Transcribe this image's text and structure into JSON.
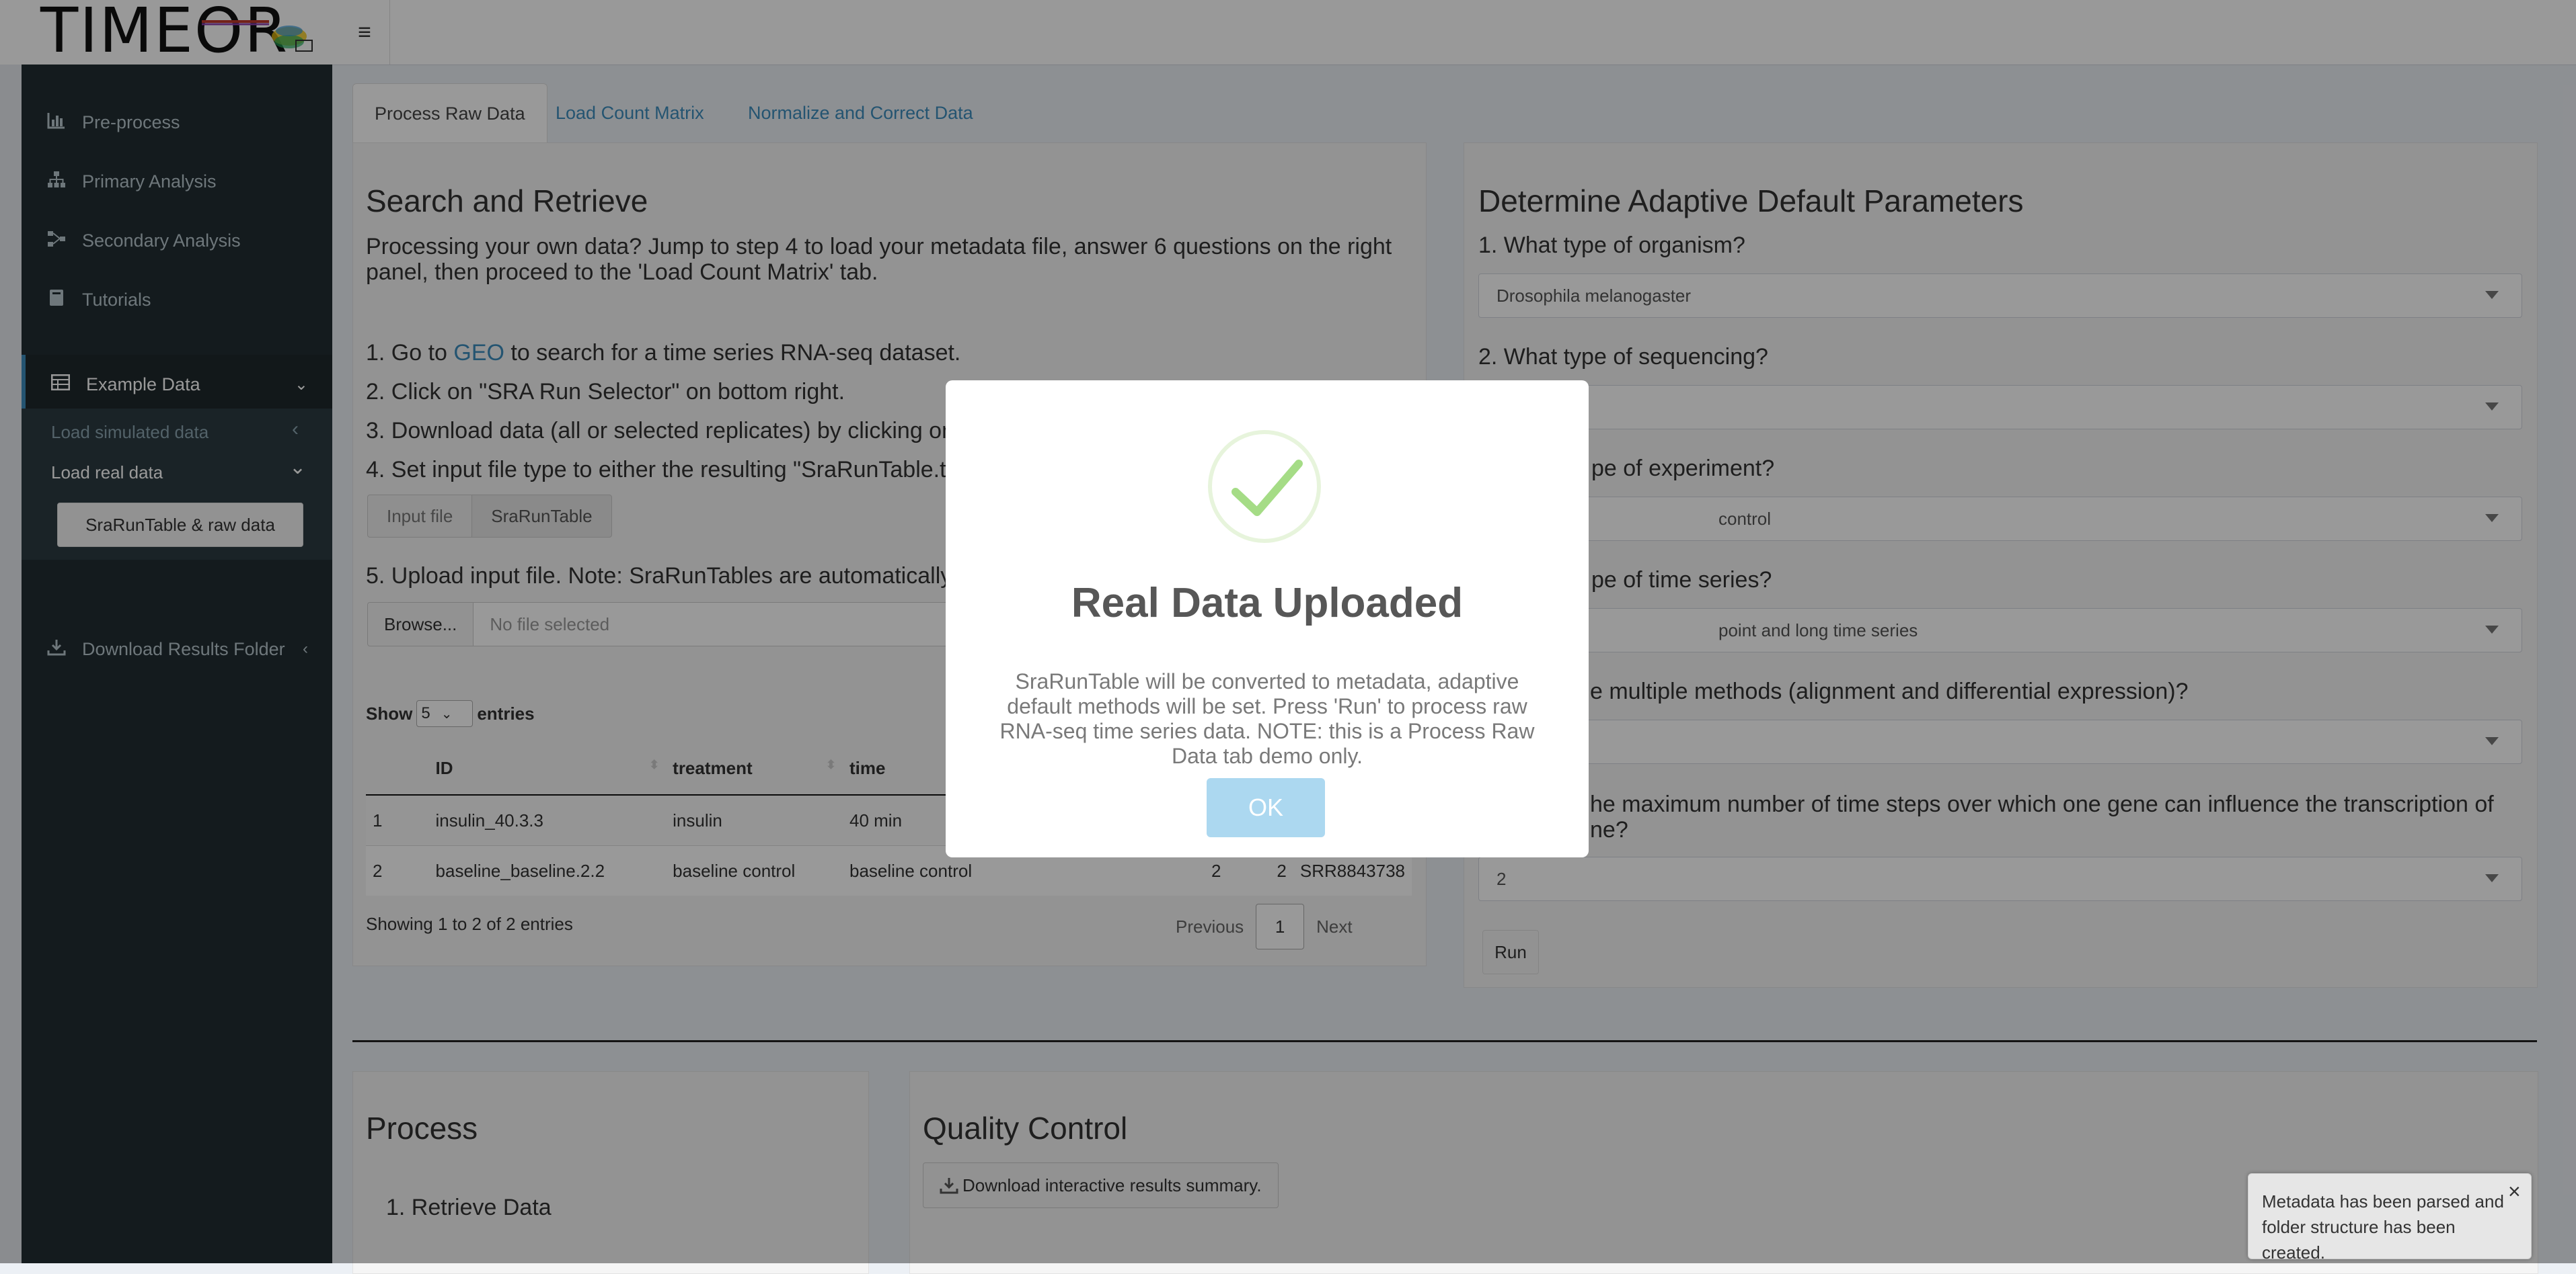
{
  "header": {
    "logo": "TIMEOR",
    "menu_icon": "hamburger-icon"
  },
  "sidebar": {
    "items": [
      {
        "label": "Pre-process",
        "icon": "bar-chart-icon"
      },
      {
        "label": "Primary Analysis",
        "icon": "sitemap-icon"
      },
      {
        "label": "Secondary Analysis",
        "icon": "network-icon"
      },
      {
        "label": "Tutorials",
        "icon": "book-icon"
      },
      {
        "label": "Example Data",
        "icon": "table-icon"
      },
      {
        "label": "Download Results Folder",
        "icon": "download-icon"
      }
    ],
    "sub_items": {
      "simulated": "Load simulated data",
      "real": "Load real data",
      "sra_button": "SraRunTable & raw data"
    }
  },
  "tabs": [
    "Process Raw Data",
    "Load Count Matrix",
    "Normalize and Correct Data"
  ],
  "left": {
    "title": "Search and Retrieve",
    "intro": "Processing your own data? Jump to step 4 to load your metadata file, answer 6 questions on the right panel, then proceed to the 'Load Count Matrix' tab.",
    "step1_pre": "1. Go to ",
    "step1_link": "GEO",
    "step1_post": " to search for a time series RNA-seq dataset.",
    "step2": "2. Click on \"SRA Run Selector\" on bottom right.",
    "step3": "3. Download data (all or selected replicates) by clicking on",
    "step4": "4. Set input file type to either the resulting \"SraRunTable.t",
    "toggle": [
      "Input file",
      "SraRunTable"
    ],
    "step5": "5. Upload input file. Note: SraRunTables are automatically",
    "browse_label": "Browse...",
    "file_placeholder": "No file selected",
    "show_label": "Show",
    "entries_value": "5",
    "entries_label": "entries",
    "columns": [
      "",
      "ID",
      "treatment",
      "time",
      "",
      "",
      ""
    ],
    "rows": [
      [
        "1",
        "insulin_40.3.3",
        "insulin",
        "40 min",
        "",
        "",
        ""
      ],
      [
        "2",
        "baseline_baseline.2.2",
        "baseline control",
        "baseline control",
        "2",
        "2",
        "SRR8843738"
      ]
    ],
    "info": "Showing 1 to 2 of 2 entries",
    "pager": {
      "prev": "Previous",
      "page": "1",
      "next": "Next"
    }
  },
  "right": {
    "title": "Determine Adaptive Default Parameters",
    "questions": [
      {
        "label": "1. What type of organism?",
        "value": "Drosophila melanogaster"
      },
      {
        "label": "2. What type of sequencing?",
        "value": ""
      },
      {
        "label": "pe of experiment?",
        "value": "control"
      },
      {
        "label": "pe of time series?",
        "value": "point and long time series"
      },
      {
        "label": "e multiple methods (alignment and differential expression)?",
        "value": ""
      },
      {
        "label": "he maximum number of time steps over which one gene can influence the transcription of ne?",
        "value": "2"
      }
    ],
    "run_label": "Run"
  },
  "bottom": {
    "process_title": "Process",
    "retrieve_step": "1. Retrieve Data",
    "qc_title": "Quality Control",
    "download_summary": "Download interactive results summary."
  },
  "modal": {
    "title": "Real Data Uploaded",
    "body": "SraRunTable will be converted to metadata, adaptive default methods will be set. Press 'Run' to process raw RNA-seq time series data. NOTE: this is a Process Raw Data tab demo only.",
    "ok": "OK",
    "icon": "check-icon"
  },
  "notification": {
    "text": "Metadata has been parsed and folder structure has been created.",
    "close": "×"
  },
  "colors": {
    "sidebar": "#222d32",
    "link": "#3c8dbc",
    "ok_button": "#acd8f0",
    "success_check": "#a5dc86"
  }
}
